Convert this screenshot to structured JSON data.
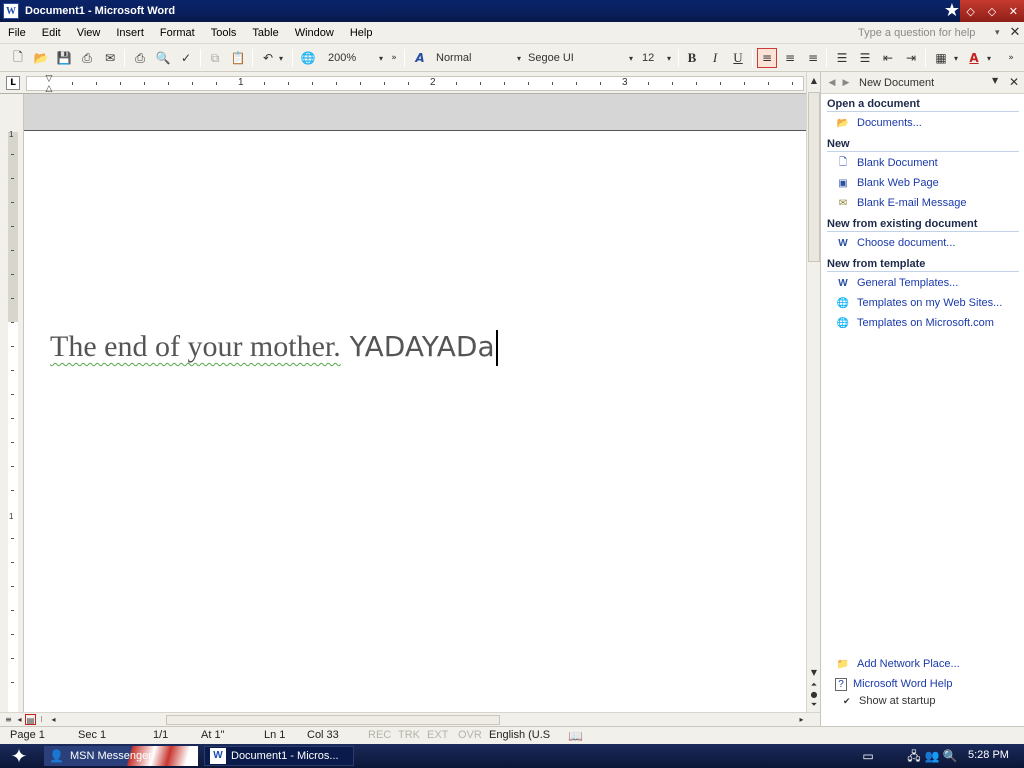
{
  "window": {
    "title": "Document1 - Microsoft Word",
    "app_icon_letter": "W"
  },
  "menu": {
    "items": [
      "File",
      "Edit",
      "View",
      "Insert",
      "Format",
      "Tools",
      "Table",
      "Window",
      "Help"
    ],
    "help_placeholder": "Type a question for help"
  },
  "toolbar": {
    "zoom": "200%",
    "style": "Normal",
    "font": "Segoe UI",
    "size": "12",
    "bold_label": "B",
    "italic_label": "I",
    "underline_label": "U"
  },
  "ruler": {
    "numbers": [
      "1",
      "2",
      "3"
    ]
  },
  "document": {
    "text_serif": "The end of your mother.",
    "text_sans": " YADAYADa"
  },
  "task_pane": {
    "title": "New Document",
    "sections": [
      {
        "heading": "Open a document",
        "links": [
          {
            "label": "Documents...",
            "icon": "folder-open-icon"
          }
        ]
      },
      {
        "heading": "New",
        "links": [
          {
            "label": "Blank Document",
            "icon": "blank-document-icon"
          },
          {
            "label": "Blank Web Page",
            "icon": "web-page-icon"
          },
          {
            "label": "Blank E-mail Message",
            "icon": "email-icon"
          }
        ]
      },
      {
        "heading": "New from existing document",
        "links": [
          {
            "label": "Choose document...",
            "icon": "word-document-icon"
          }
        ]
      },
      {
        "heading": "New from template",
        "links": [
          {
            "label": "General Templates...",
            "icon": "word-document-icon"
          },
          {
            "label": "Templates on my Web Sites...",
            "icon": "web-templates-icon"
          },
          {
            "label": "Templates on Microsoft.com",
            "icon": "globe-icon"
          }
        ]
      }
    ],
    "bottom_links": [
      {
        "label": "Add Network Place...",
        "icon": "network-folder-icon"
      },
      {
        "label": "Microsoft Word Help",
        "icon": "help-icon"
      }
    ],
    "show_at_startup": "Show at startup"
  },
  "statusbar": {
    "page": "Page  1",
    "sec": "Sec  1",
    "pages": "1/1",
    "at": "At  1\"",
    "ln": "Ln  1",
    "col": "Col  33",
    "rec": "REC",
    "trk": "TRK",
    "ext": "EXT",
    "ovr": "OVR",
    "language": "English (U.S"
  },
  "taskbar": {
    "task1": "MSN Messenger",
    "task2": "Document1 - Micros...",
    "clock": "5:28 PM"
  }
}
